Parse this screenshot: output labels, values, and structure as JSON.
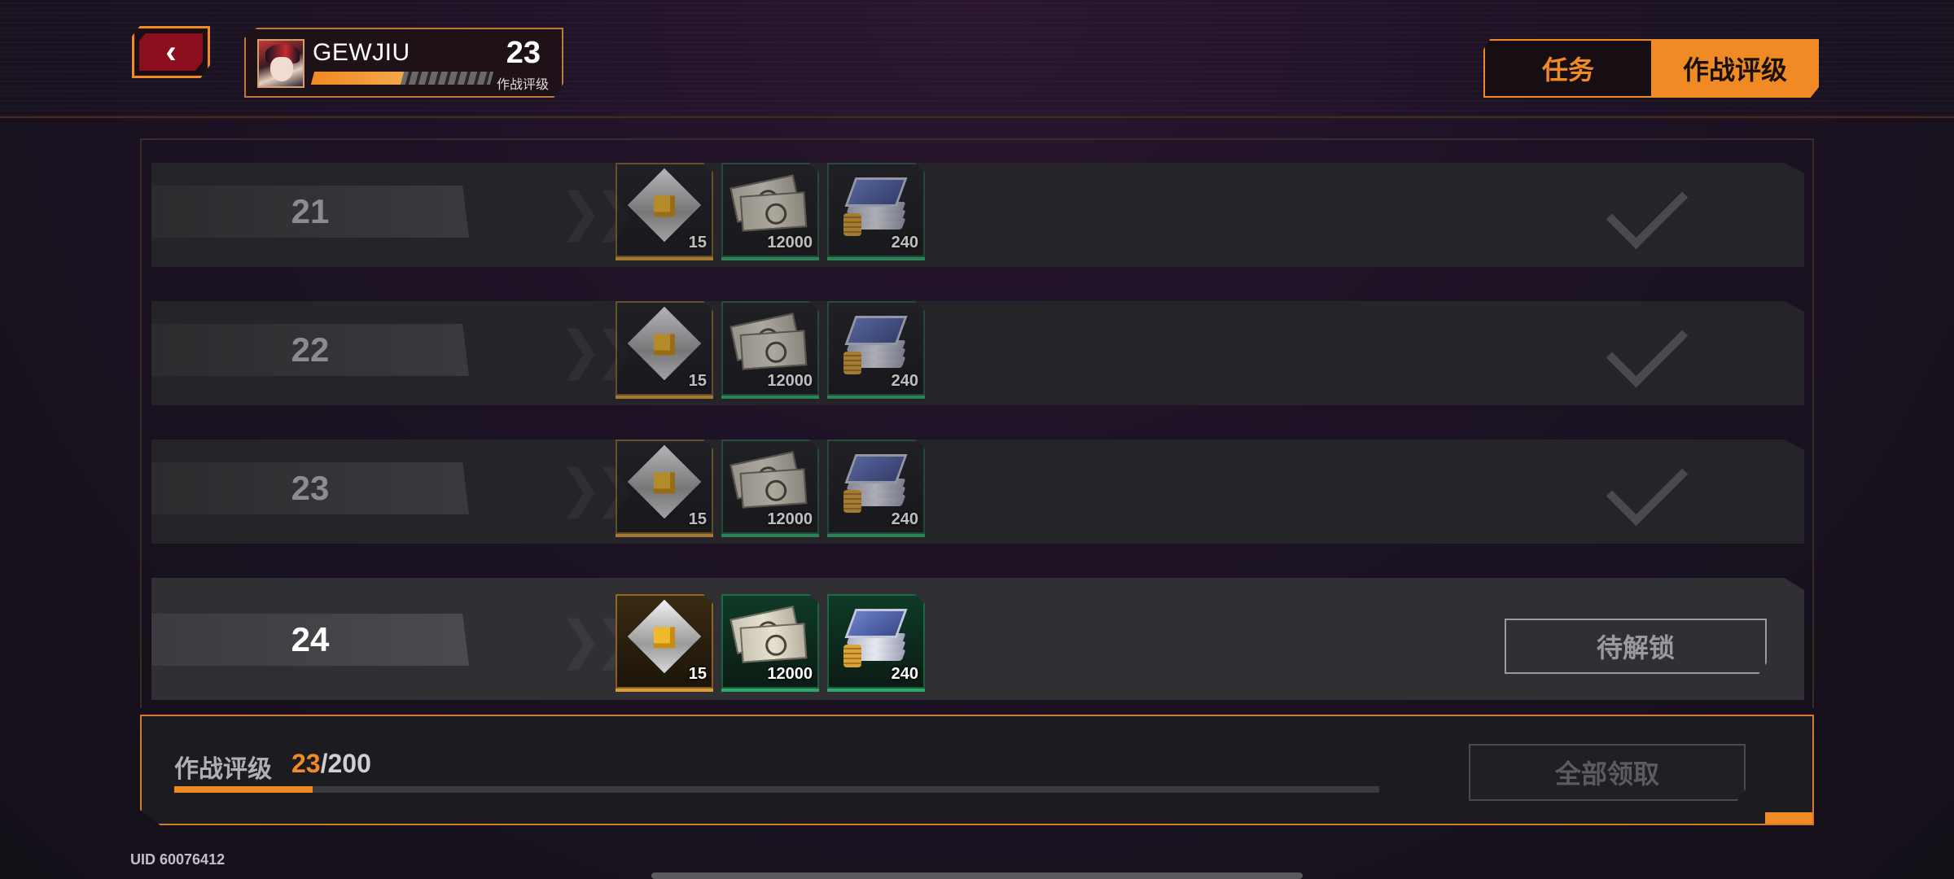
{
  "header": {
    "back_icon": "chevron-left-icon",
    "player": {
      "name": "GEWJIU",
      "level": "23",
      "level_label": "作战评级",
      "xp_fraction": 0.5
    },
    "tabs": [
      {
        "label": "任务",
        "active": false
      },
      {
        "label": "作战评级",
        "active": true
      }
    ]
  },
  "rows": [
    {
      "level": "21",
      "state": "claimed",
      "rewards": [
        {
          "icon": "diamond-cube-icon",
          "count": "15",
          "rarity": "gold"
        },
        {
          "icon": "banknote-icon",
          "count": "12000",
          "rarity": "green"
        },
        {
          "icon": "chip-stack-icon",
          "count": "240",
          "rarity": "green"
        }
      ]
    },
    {
      "level": "22",
      "state": "claimed",
      "rewards": [
        {
          "icon": "diamond-cube-icon",
          "count": "15",
          "rarity": "gold"
        },
        {
          "icon": "banknote-icon",
          "count": "12000",
          "rarity": "green"
        },
        {
          "icon": "chip-stack-icon",
          "count": "240",
          "rarity": "green"
        }
      ]
    },
    {
      "level": "23",
      "state": "claimed",
      "rewards": [
        {
          "icon": "diamond-cube-icon",
          "count": "15",
          "rarity": "gold"
        },
        {
          "icon": "banknote-icon",
          "count": "12000",
          "rarity": "green"
        },
        {
          "icon": "chip-stack-icon",
          "count": "240",
          "rarity": "green"
        }
      ]
    },
    {
      "level": "24",
      "state": "locked",
      "button_label": "待解锁",
      "rewards": [
        {
          "icon": "diamond-cube-icon",
          "count": "15",
          "rarity": "gold"
        },
        {
          "icon": "banknote-icon",
          "count": "12000",
          "rarity": "green"
        },
        {
          "icon": "chip-stack-icon",
          "count": "240",
          "rarity": "green"
        }
      ]
    }
  ],
  "footer": {
    "rank_label": "作战评级",
    "rank_current": "23",
    "rank_max": "/200",
    "progress_fraction": 0.115,
    "claim_all_label": "全部领取",
    "uid": "UID 60076412"
  },
  "colors": {
    "accent": "#f08a24",
    "gold": "#d99b3a",
    "green": "#2fa868"
  }
}
